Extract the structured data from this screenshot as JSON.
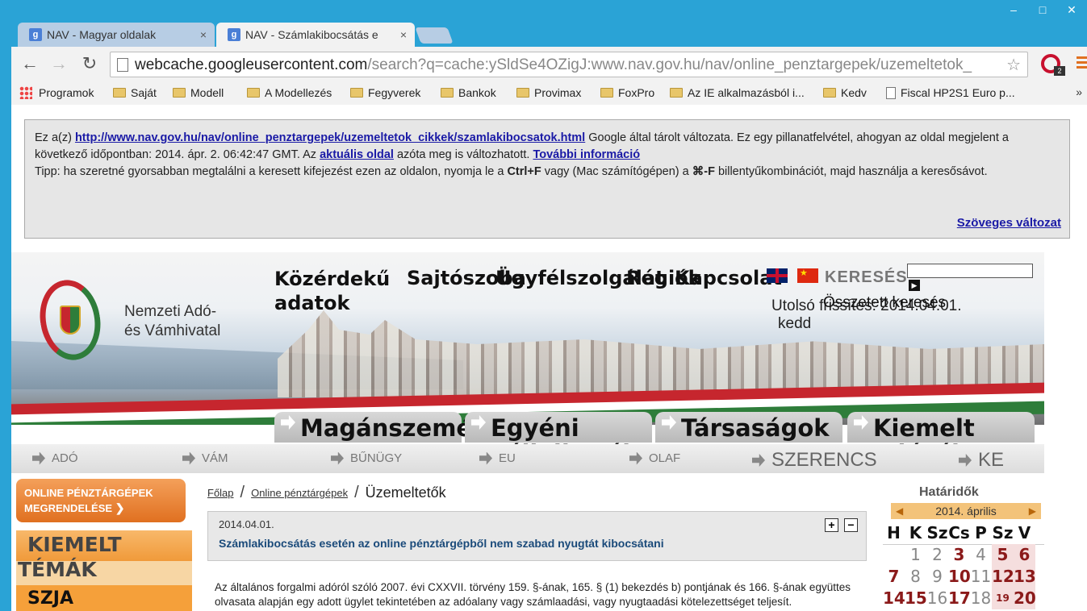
{
  "window": {
    "controls": [
      "–",
      "□",
      "✕"
    ]
  },
  "tabs": [
    {
      "label": "NAV - Magyar oldalak",
      "favicon": "g",
      "close": "×"
    },
    {
      "label": "NAV - Számlakibocsátás e",
      "favicon": "g",
      "close": "×"
    }
  ],
  "toolbar": {
    "back": "←",
    "forward": "→",
    "reload": "↻",
    "url_host": "webcache.googleusercontent.com",
    "url_rest": "/search?q=cache:ySldSe4OZigJ:www.nav.gov.hu/nav/online_penztargepek/uzemeltetok_",
    "star": "☆",
    "opera_badge": "2"
  },
  "bookmarks": {
    "items": [
      "Programok",
      "Saját",
      "Modell",
      "A Modellezés",
      "Fegyverek",
      "Bankok",
      "Provimax",
      "FoxPro",
      "Az IE alkalmazásból i...",
      "Kedv",
      "Fiscal HP2S1 Euro p..."
    ],
    "more": "»"
  },
  "cache_notice": {
    "prefix": "Ez a(z)",
    "link": "http://www.nav.gov.hu/nav/online_penztargepek/uzemeltetok_cikkek/szamlakibocsatok.html",
    "text1": "Google által tárolt változata. Ez egy pillanatfelvétel, ahogyan az oldal megjelent a következő időpontban: 2014. ápr. 2. 06:42:47 GMT. Az",
    "current_link": "aktuális oldal",
    "text2": "azóta meg is változhatott.",
    "more_link": "További információ",
    "tip_prefix": "Tipp: ha szeretné gyorsabban megtalálni a keresett kifejezést ezen az oldalon, nyomja le a",
    "kbd1": "Ctrl+F",
    "tip_mid": "vagy (Mac számítógépen) a",
    "kbd2": "⌘-F",
    "tip_end": "billentyűkombinációt, majd használja a keresősávot.",
    "plain_link": "Szöveges változat"
  },
  "header": {
    "logo_line1": "Nemzeti Adó-",
    "logo_line2": "és Vámhivatal",
    "topnav": [
      "Közérdekű",
      "adatok",
      "Sajtószoba",
      "Ügyfélszolgálat",
      "Régiók",
      "Kapcsolat"
    ],
    "kereses": "KERESÉS",
    "osszetett": "Összetett keresés",
    "utolso_line1": "Utolsó frissítés: 2014.04.01.",
    "utolso_line2": "kedd"
  },
  "main_tabs": [
    "Magánszemé",
    "Egyéni vállalkozók",
    "Társaságok",
    "Kiemelt adózók"
  ],
  "subnav": [
    "ADÓ",
    "VÁM",
    "BŰNÜGY",
    "EU",
    "OLAF",
    "SZERENCS",
    "KE"
  ],
  "left": {
    "order_line1": "ONLINE PÉNZTÁRGÉPEK",
    "order_line2": "MEGRENDELÉSE",
    "order_chev": "❯",
    "kiemelt1": "KIEMELT",
    "kiemelt2": "TÉMÁK",
    "szja": "SZJA"
  },
  "content": {
    "crumb1": "Főlap",
    "crumb2": "Online pénztárgépek",
    "crumb3": "Üzemeltetők",
    "sep": "/",
    "date": "2014.04.01.",
    "title": "Számlakibocsátás esetén az online pénztárgépből nem szabad nyugtát kibocsátani",
    "plus": "+",
    "minus": "−",
    "body": "Az általános forgalmi adóról szóló 2007. évi CXXVII. törvény 159. §-ának, 165. § (1) bekezdés b) pontjának és 166. §-ának együttes olvasata alapján egy adott ügylet tekintetében az adóalany vagy számlaadási, vagy nyugtaadási kötelezettséget teljesít."
  },
  "calendar": {
    "title": "Határidők",
    "month": "2014. április",
    "prev": "◀",
    "next": "▶",
    "headers": [
      "H",
      "K",
      "Sz",
      "Cs",
      "P",
      "Sz",
      "V"
    ],
    "rows": [
      [
        "",
        "1",
        "2",
        "3",
        "4",
        "5",
        "6"
      ],
      [
        "7",
        "8",
        "9",
        "10",
        "11",
        "12",
        "13"
      ],
      [
        "14",
        "15",
        "16",
        "17",
        "18",
        "19",
        "20"
      ]
    ]
  },
  "colors": {
    "chrome_blue": "#2aa3d6",
    "accent_orange": "#e07020",
    "flag_red": "#c6262e",
    "flag_green": "#2e7d3a",
    "link_blue": "#1a1aa6"
  }
}
